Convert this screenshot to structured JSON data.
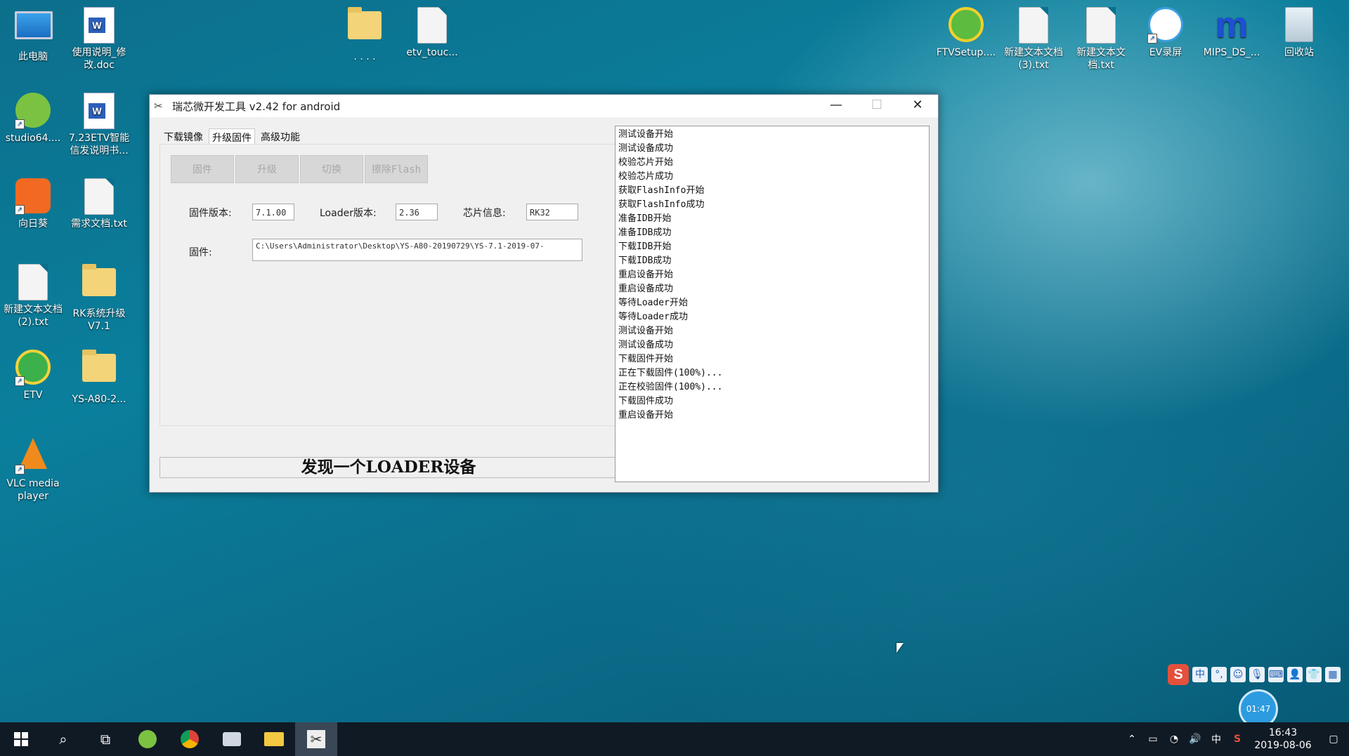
{
  "desktop": {
    "icons": [
      {
        "label": "此电脑",
        "icon": "computer-icon"
      },
      {
        "label": "使用说明_修改.doc",
        "icon": "word-doc-icon"
      },
      {
        "label": ". . . .",
        "icon": "folder-icon"
      },
      {
        "label": "etv_touc...",
        "icon": "file-icon"
      },
      {
        "label": "studio64....",
        "icon": "android-studio-icon"
      },
      {
        "label": "7.23ETV智能信发说明书...",
        "icon": "word-doc-icon"
      },
      {
        "label": "向日葵",
        "icon": "sunflower-icon"
      },
      {
        "label": "需求文档.txt",
        "icon": "text-file-icon"
      },
      {
        "label": "新建文本文档(2).txt",
        "icon": "text-file-icon"
      },
      {
        "label": "RK系统升级V7.1",
        "icon": "folder-icon"
      },
      {
        "label": "ETV",
        "icon": "etv-icon"
      },
      {
        "label": "YS-A80-2...",
        "icon": "zip-folder-icon"
      },
      {
        "label": "VLC media player",
        "icon": "vlc-icon"
      },
      {
        "label": "FTVSetup....",
        "icon": "ftv-setup-icon"
      },
      {
        "label": "新建文本文档(3).txt",
        "icon": "text-file-icon"
      },
      {
        "label": "新建文本文档.txt",
        "icon": "text-file-icon"
      },
      {
        "label": "EV录屏",
        "icon": "ev-recorder-icon"
      },
      {
        "label": "MIPS_DS_...",
        "icon": "mips-icon"
      },
      {
        "label": "回收站",
        "icon": "recycle-bin-icon"
      }
    ]
  },
  "window": {
    "title": "瑞芯微开发工具 v2.42 for android",
    "tabs": [
      "下载镜像",
      "升级固件",
      "高级功能"
    ],
    "active_tab": "升级固件",
    "toolbar": {
      "firmware_button": "固件",
      "upgrade_button": "升级",
      "switch_button": "切换",
      "erase_button": "擦除Flash"
    },
    "fields": {
      "firmware_version_label": "固件版本:",
      "firmware_version_value": "7.1.00",
      "loader_version_label": "Loader版本:",
      "loader_version_value": "2.36",
      "chip_info_label": "芯片信息:",
      "chip_info_value": "RK32",
      "firmware_path_label": "固件:",
      "firmware_path_value": "C:\\Users\\Administrator\\Desktop\\YS-A80-20190729\\YS-7.1-2019-07-"
    },
    "status": "发现一个LOADER设备",
    "log": [
      "测试设备开始",
      "测试设备成功",
      "校验芯片开始",
      "校验芯片成功",
      "获取FlashInfo开始",
      "获取FlashInfo成功",
      "准备IDB开始",
      "准备IDB成功",
      "下载IDB开始",
      "下载IDB成功",
      "重启设备开始",
      "重启设备成功",
      "等待Loader开始",
      "等待Loader成功",
      "测试设备开始",
      "测试设备成功",
      "下载固件开始",
      "正在下载固件(100%)...",
      "正在校验固件(100%)...",
      "下载固件成功",
      "重启设备开始"
    ]
  },
  "ime": {
    "logo": "S",
    "mode": "中"
  },
  "timer": "01:47",
  "taskbar": {
    "tray_lang": "中",
    "time": "16:43",
    "date": "2019-08-06"
  }
}
